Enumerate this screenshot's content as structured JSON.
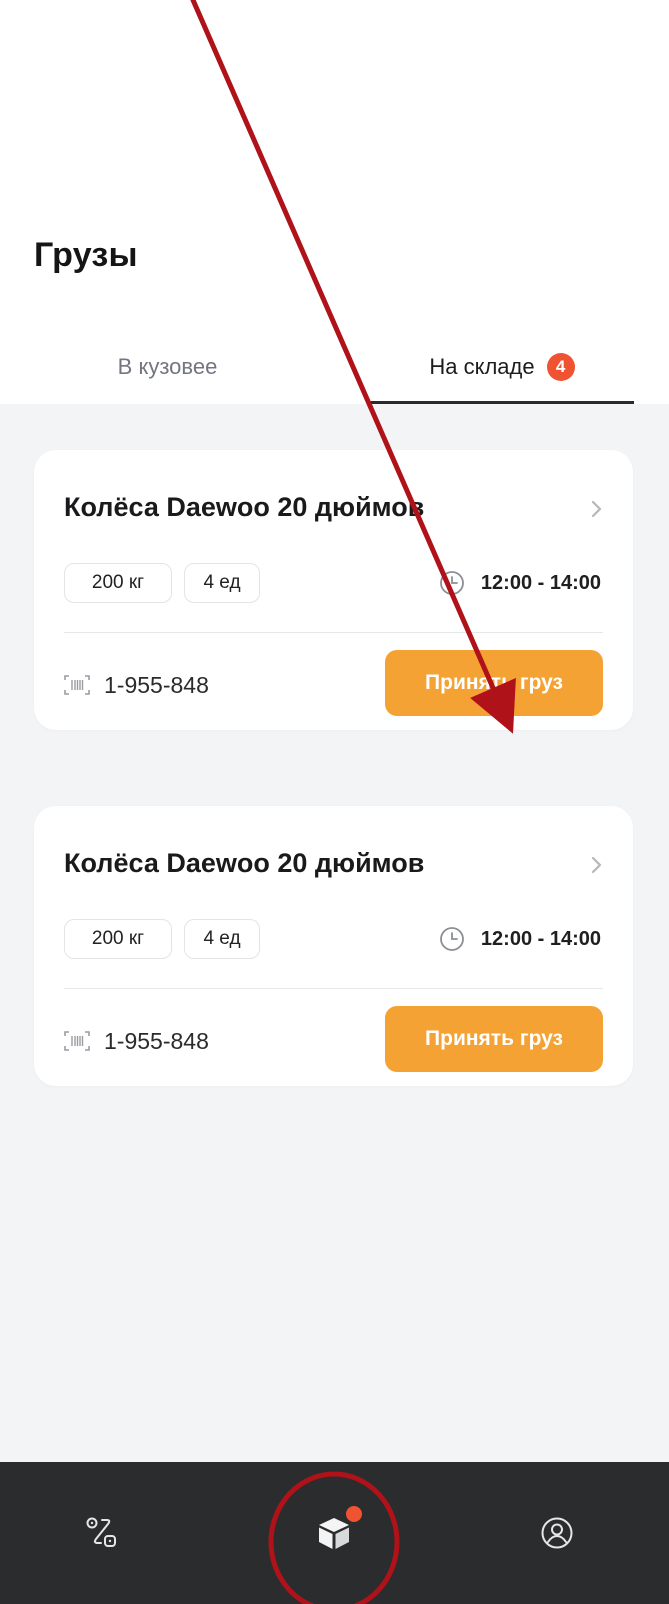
{
  "colors": {
    "accent": "#f5a234",
    "badge": "#ef5331",
    "nav_background": "#2b2c2e",
    "content_background": "#f3f4f6",
    "annotation": "#b0121a"
  },
  "header": {
    "title": "Грузы"
  },
  "tabs": [
    {
      "label": "В кузовее",
      "active": false
    },
    {
      "label": "На складе",
      "active": true,
      "badge": "4"
    }
  ],
  "cards": [
    {
      "title": "Колёса Daewoo 20 дюймов",
      "weight": "200 кг",
      "quantity": "4 ед",
      "time": "12:00 - 14:00",
      "code": "1-955-848",
      "action_label": "Принять груз",
      "icons": {
        "open": "chevron-right-icon",
        "time": "clock-icon",
        "code": "barcode-icon"
      }
    },
    {
      "title": "Колёса Daewoo 20 дюймов",
      "weight": "200 кг",
      "quantity": "4 ед",
      "time": "12:00 - 14:00",
      "code": "1-955-848",
      "action_label": "Принять груз",
      "icons": {
        "open": "chevron-right-icon",
        "time": "clock-icon",
        "code": "barcode-icon"
      }
    }
  ],
  "bottom_nav": [
    {
      "icon": "route-icon",
      "active": false
    },
    {
      "icon": "package-icon",
      "active": true,
      "has_notification_dot": true
    },
    {
      "icon": "profile-icon",
      "active": false
    }
  ],
  "annotations": {
    "arrow": "arrow pointing to accept-cargo button",
    "circle": "circle highlighting cargo tab"
  }
}
